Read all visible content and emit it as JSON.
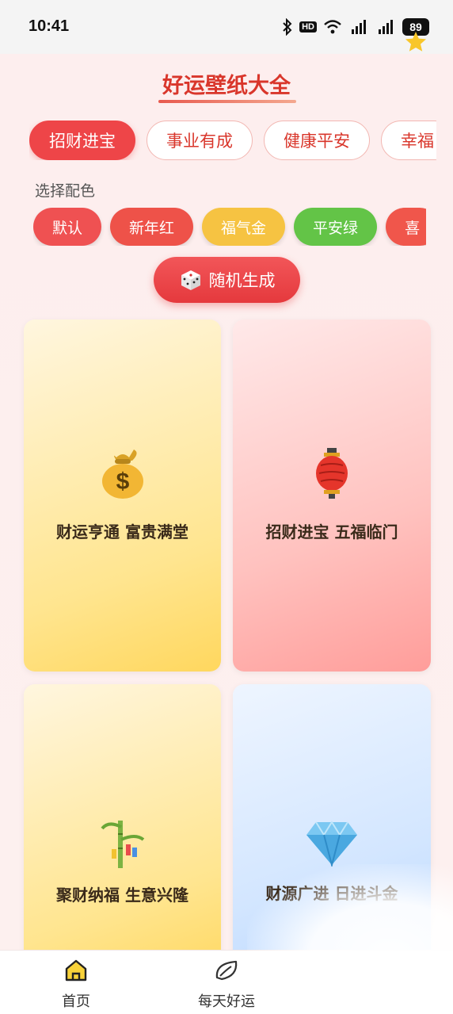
{
  "status_bar": {
    "time": "10:41",
    "battery": "89",
    "hd_label": "HD"
  },
  "header": {
    "title": "好运壁纸大全"
  },
  "tabs": [
    {
      "label": "招财进宝",
      "active": true
    },
    {
      "label": "事业有成",
      "active": false
    },
    {
      "label": "健康平安",
      "active": false
    },
    {
      "label": "幸福",
      "active": false
    }
  ],
  "color_section": {
    "label": "选择配色",
    "options": [
      {
        "label": "默认",
        "color": "#ef5152"
      },
      {
        "label": "新年红",
        "color": "#ee5249"
      },
      {
        "label": "福气金",
        "color": "#f6c342"
      },
      {
        "label": "平安绿",
        "color": "#63c447"
      },
      {
        "label": "喜",
        "color": "#f0564b"
      }
    ]
  },
  "random_button": {
    "label": "随机生成",
    "icon": "dice-icon"
  },
  "cards": [
    {
      "text": "财运亨通 富贵满堂",
      "icon": "money-bag-icon",
      "gradient": [
        "#fff6df",
        "#ffd75e"
      ]
    },
    {
      "text": "招财进宝 五福临门",
      "icon": "lantern-icon",
      "gradient": [
        "#ffe6e6",
        "#ff9d9a"
      ]
    },
    {
      "text": "聚财纳福 生意兴隆",
      "icon": "bamboo-icon",
      "gradient": [
        "#fff6df",
        "#ffd75e"
      ]
    },
    {
      "text": "财源广进 日进斗金",
      "icon": "gem-icon",
      "gradient": [
        "#eef5ff",
        "#b7d6ff"
      ]
    }
  ],
  "bottom_nav": {
    "items": [
      {
        "label": "首页",
        "icon": "home-icon",
        "active": true
      },
      {
        "label": "每天好运",
        "icon": "leaf-icon",
        "active": false
      }
    ]
  }
}
